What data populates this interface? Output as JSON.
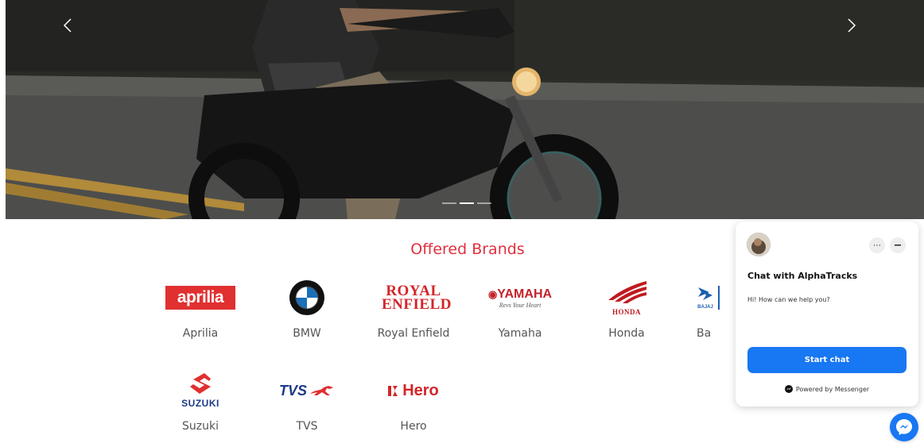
{
  "hero": {
    "prev_icon": "chevron-left-icon",
    "next_icon": "chevron-right-icon",
    "slides_count": 3,
    "active_slide": 2
  },
  "brands_section": {
    "title": "Offered Brands",
    "brands": [
      {
        "name": "Aprilia",
        "logo_text": "aprilia"
      },
      {
        "name": "BMW",
        "logo_text": "BMW"
      },
      {
        "name": "Royal Enfield",
        "logo_text": "ROYAL ENFIELD"
      },
      {
        "name": "Yamaha",
        "logo_text": "YAMAHA",
        "logo_tagline": "Revs Your Heart"
      },
      {
        "name": "Honda",
        "logo_text": "HONDA"
      },
      {
        "name": "Ba",
        "logo_text": "BAJAJ"
      },
      {
        "name": "Suzuki",
        "logo_text": "SUZUKI"
      },
      {
        "name": "TVS",
        "logo_text": "TVS"
      },
      {
        "name": "Hero",
        "logo_text": "Hero"
      }
    ]
  },
  "chat": {
    "title": "Chat with AlphaTracks",
    "greeting": "Hi! How can we help you?",
    "start_button": "Start chat",
    "powered_by": "Powered by Messenger",
    "more_icon": "more-options-icon",
    "minimize_icon": "minimize-icon"
  },
  "colors": {
    "accent": "#e0303f",
    "messenger_blue": "#1877f2"
  }
}
